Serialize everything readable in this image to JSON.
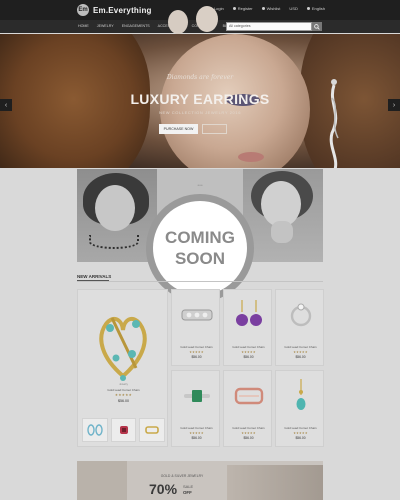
{
  "brand": {
    "logo_mark": "Em",
    "name": "Em.Everything"
  },
  "topnav": {
    "login": "Login",
    "register": "Register",
    "wishlist": "Wishlist",
    "currency": "USD",
    "language": "English"
  },
  "mainnav": [
    "HOME",
    "JEWELRY",
    "ENGAGEMENTS",
    "ACCESSORIES",
    "CONTACT US",
    "BLOG"
  ],
  "search": {
    "category": "All categories",
    "placeholder": ""
  },
  "hero": {
    "tagline": "Diamonds are forever",
    "title": "LUXURY EARRINGS",
    "subtitle": "NEW COLLECTION JEWELRY 2016",
    "cta_label": "PURCHASE NOW"
  },
  "banner": {
    "mid_text": "• • •"
  },
  "overlay": {
    "line1": "COMING",
    "line2": "SOON"
  },
  "section": {
    "title": "NEW ARRIVALS"
  },
  "featured": {
    "category": "Jewelry",
    "name": "Gold Lead Comet Chain",
    "stars": "★★★★★",
    "price": "$56.00"
  },
  "products": [
    {
      "name": "Gold Lead Comet Chain",
      "stars": "★★★★★",
      "price": "$56.00",
      "icon": "bracelet-icon"
    },
    {
      "name": "Gold Lead Comet Chain",
      "stars": "★★★★★",
      "price": "$56.00",
      "icon": "amethyst-earrings-icon"
    },
    {
      "name": "Gold Lead Comet Chain",
      "stars": "★★★★★",
      "price": "$56.00",
      "icon": "silver-ring-icon"
    },
    {
      "name": "Gold Lead Comet Chain",
      "stars": "★★★★★",
      "price": "$56.00",
      "icon": "emerald-ring-icon"
    },
    {
      "name": "Gold Lead Comet Chain",
      "stars": "★★★★★",
      "price": "$56.00",
      "icon": "rose-band-icon"
    },
    {
      "name": "Gold Lead Comet Chain",
      "stars": "★★★★★",
      "price": "$56.00",
      "icon": "turquoise-pendant-icon"
    }
  ],
  "promo": {
    "heading": "GOLD & SILVER JEWELRY",
    "percent": "70%",
    "sale": "SALE",
    "off": "OFF"
  },
  "arrows": {
    "left": "‹",
    "right": "›"
  },
  "colors": {
    "topbar": "#1f1f1f",
    "navbar": "#2b2b2b",
    "badge_ring": "#9a9a9a",
    "badge_text": "#8a8a8a",
    "gold": "#a88a4a"
  }
}
